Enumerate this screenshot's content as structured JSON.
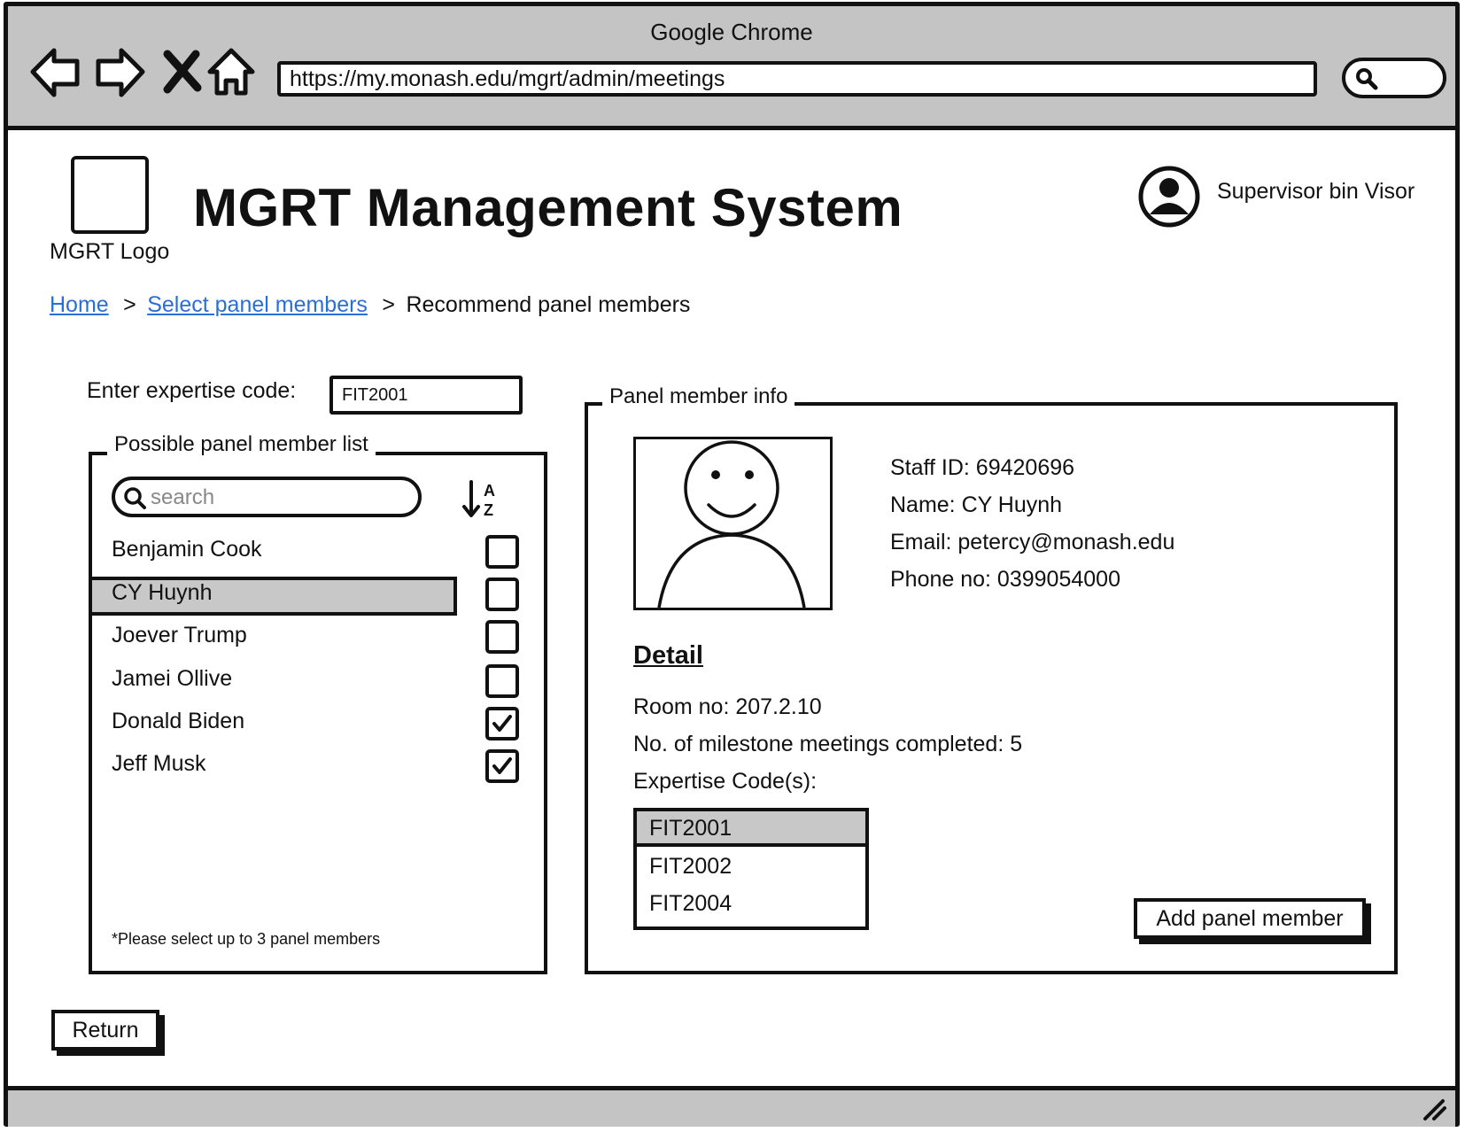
{
  "browser": {
    "title": "Google Chrome",
    "url": "https://my.monash.edu/mgrt/admin/meetings"
  },
  "header": {
    "logo_label": "MGRT Logo",
    "title": "MGRT Management System",
    "user_name": "Supervisor bin Visor"
  },
  "breadcrumb": {
    "items": [
      "Home",
      "Select panel members",
      "Recommend panel members"
    ],
    "separator": ">"
  },
  "expertise": {
    "label": "Enter expertise code:",
    "value": "FIT2001"
  },
  "member_list": {
    "legend": "Possible panel member list",
    "search_placeholder": "search",
    "members": [
      {
        "name": "Benjamin Cook",
        "checked": false
      },
      {
        "name": "CY Huynh",
        "checked": false
      },
      {
        "name": "Joever Trump",
        "checked": false
      },
      {
        "name": "Jamei Ollive",
        "checked": false
      },
      {
        "name": "Donald Biden",
        "checked": true
      },
      {
        "name": "Jeff Musk",
        "checked": true
      }
    ],
    "selected_index": 1,
    "note": "*Please select up to 3 panel members"
  },
  "member_info": {
    "legend": "Panel member info",
    "staff_id": "Staff ID: 69420696",
    "name": "Name: CY Huynh",
    "email": "Email: petercy@monash.edu",
    "phone": "Phone no: 0399054000",
    "detail_heading": "Detail",
    "room": "Room no: 207.2.10",
    "meetings": "No. of milestone meetings completed: 5",
    "expertise_label": "Expertise Code(s):",
    "codes": [
      "FIT2001",
      "FIT2002",
      "FIT2004"
    ],
    "selected_code_index": 0,
    "add_button": "Add panel member"
  },
  "return_button": "Return",
  "colors": {
    "chrome_gray": "#c4c4c4",
    "link_blue": "#2a6fd6",
    "selected_gray": "#c8c8c8"
  }
}
